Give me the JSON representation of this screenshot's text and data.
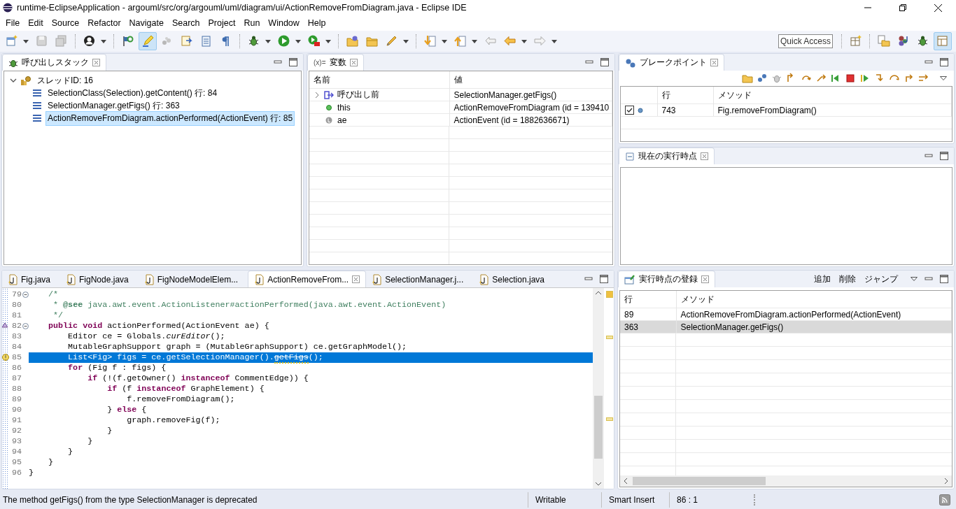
{
  "window": {
    "title": "runtime-EclipseApplication - argouml/src/org/argouml/uml/diagram/ui/ActionRemoveFromDiagram.java - Eclipse IDE"
  },
  "menu": [
    "File",
    "Edit",
    "Source",
    "Refactor",
    "Navigate",
    "Search",
    "Project",
    "Run",
    "Window",
    "Help"
  ],
  "toolbar": [
    {
      "kind": "new-file",
      "menu": true,
      "selected": false
    },
    {
      "kind": "save",
      "menu": false,
      "selected": false
    },
    {
      "kind": "save-all",
      "menu": false,
      "selected": false
    },
    {
      "kind": "separator"
    },
    {
      "kind": "user",
      "menu": true,
      "selected": false
    },
    {
      "kind": "separator"
    },
    {
      "kind": "flag",
      "menu": false,
      "selected": false
    },
    {
      "kind": "pen",
      "menu": false,
      "selected": true
    },
    {
      "kind": "dots",
      "menu": false,
      "selected": false
    },
    {
      "kind": "document",
      "menu": false,
      "selected": false
    },
    {
      "kind": "list",
      "menu": false,
      "selected": false
    },
    {
      "kind": "pilcrow",
      "menu": false,
      "selected": false
    },
    {
      "kind": "separator"
    },
    {
      "kind": "bug",
      "menu": true,
      "selected": false
    },
    {
      "kind": "run",
      "menu": true,
      "selected": false
    },
    {
      "kind": "run-tool",
      "menu": true,
      "selected": false
    },
    {
      "kind": "separator"
    },
    {
      "kind": "folder-sphere",
      "menu": false,
      "selected": false
    },
    {
      "kind": "folder",
      "menu": false,
      "selected": false
    },
    {
      "kind": "brush",
      "menu": true,
      "selected": false
    },
    {
      "kind": "separator"
    },
    {
      "kind": "arrow-down",
      "menu": true,
      "selected": false
    },
    {
      "kind": "arrow-up",
      "menu": true,
      "selected": false
    },
    {
      "kind": "back",
      "menu": false,
      "selected": false
    },
    {
      "kind": "arrow-left",
      "menu": true,
      "selected": false
    },
    {
      "kind": "arrow-right",
      "menu": true,
      "selected": false
    }
  ],
  "quick_access": {
    "placeholder": "Quick Access"
  },
  "perspectives": [
    {
      "kind": "table-plus",
      "selected": false
    },
    {
      "kind": "documents",
      "selected": false
    },
    {
      "kind": "beans",
      "selected": false
    },
    {
      "kind": "bug",
      "selected": false
    },
    {
      "kind": "layout",
      "selected": true
    }
  ],
  "call_stack": {
    "tab": {
      "label": "呼び出しスタック",
      "selected": true
    },
    "threads": [
      {
        "label": "スレッドID: 16",
        "expanded": true,
        "children": [
          {
            "label": "SelectionClass(Selection).getContent() 行: 84",
            "selected": false
          },
          {
            "label": "SelectionManager.getFigs() 行: 363",
            "selected": false
          },
          {
            "label": "ActionRemoveFromDiagram.actionPerformed(ActionEvent) 行: 85",
            "selected": true
          }
        ]
      }
    ]
  },
  "variables": {
    "tab": {
      "icon_text": "(x)=",
      "label": "変数",
      "selected": true
    },
    "columns": [
      "名前",
      "値"
    ],
    "rows": [
      {
        "kind": "return",
        "name": "呼び出し前",
        "value": "SelectionManager.getFigs()",
        "expanded": false
      },
      {
        "kind": "field",
        "name": "this",
        "value": "ActionRemoveFromDiagram (id = 139410"
      },
      {
        "kind": "local",
        "name": "ae",
        "value": "ActionEvent (id = 1882636671)"
      }
    ]
  },
  "breakpoints": {
    "tab": {
      "label": "ブレークポイント",
      "selected": true
    },
    "columns": [
      "行",
      "メソッド"
    ],
    "rows": [
      {
        "checked": true,
        "line": "743",
        "method": "Fig.removeFromDiagram()"
      }
    ]
  },
  "current_point": {
    "tab": {
      "label": "現在の実行時点",
      "selected": true
    }
  },
  "editor": {
    "tabs": [
      {
        "label": "Fig.java",
        "selected": false
      },
      {
        "label": "FigNode.java",
        "selected": false
      },
      {
        "label": "FigNodeModelElem...",
        "selected": false
      },
      {
        "label": "ActionRemoveFrom...",
        "selected": true
      },
      {
        "label": "SelectionManager.j...",
        "selected": false
      },
      {
        "label": "Selection.java",
        "selected": false
      }
    ],
    "lines": [
      {
        "number": "79",
        "fold": true,
        "kind": "plain",
        "selected": false,
        "tokens": [
          {
            "kind": "comment",
            "text": "    /*"
          }
        ]
      },
      {
        "number": "80",
        "fold": false,
        "kind": "plain",
        "selected": false,
        "tokens": [
          {
            "kind": "comment",
            "text": "     * "
          },
          {
            "kind": "doc-tag",
            "text": "@see"
          },
          {
            "kind": "comment",
            "text": " java.awt.event.ActionListener#actionPerformed(java.awt.event.ActionEvent)"
          }
        ]
      },
      {
        "number": "81",
        "fold": false,
        "kind": "plain",
        "selected": false,
        "tokens": [
          {
            "kind": "comment",
            "text": "     */"
          }
        ]
      },
      {
        "number": "82",
        "fold": true,
        "kind": "override",
        "selected": false,
        "tokens": [
          {
            "kind": "keyword",
            "text": "    public void"
          },
          {
            "kind": "plain",
            "text": " actionPerformed(ActionEvent ae) {"
          }
        ]
      },
      {
        "number": "83",
        "fold": false,
        "kind": "plain",
        "selected": false,
        "tokens": [
          {
            "kind": "plain",
            "text": "        Editor ce = Globals."
          },
          {
            "kind": "static",
            "text": "curEditor"
          },
          {
            "kind": "plain",
            "text": "();"
          }
        ]
      },
      {
        "number": "84",
        "fold": false,
        "kind": "plain",
        "selected": false,
        "tokens": [
          {
            "kind": "plain",
            "text": "        MutableGraphSupport graph = (MutableGraphSupport) ce.getGraphModel();"
          }
        ]
      },
      {
        "number": "85",
        "fold": false,
        "kind": "warning",
        "selected": true,
        "tokens": [
          {
            "kind": "plain",
            "text": "        List<Fig> figs = ce.getSelectionManager()."
          },
          {
            "kind": "deprecated",
            "text": "getFigs"
          },
          {
            "kind": "plain",
            "text": "();"
          }
        ]
      },
      {
        "number": "86",
        "fold": false,
        "kind": "plain",
        "selected": false,
        "tokens": [
          {
            "kind": "keyword",
            "text": "        for"
          },
          {
            "kind": "plain",
            "text": " (Fig f : figs) {"
          }
        ]
      },
      {
        "number": "87",
        "fold": false,
        "kind": "plain",
        "selected": false,
        "tokens": [
          {
            "kind": "keyword",
            "text": "            if"
          },
          {
            "kind": "plain",
            "text": " (!(f.getOwner() "
          },
          {
            "kind": "keyword",
            "text": "instanceof"
          },
          {
            "kind": "plain",
            "text": " CommentEdge)) {"
          }
        ]
      },
      {
        "number": "88",
        "fold": false,
        "kind": "plain",
        "selected": false,
        "tokens": [
          {
            "kind": "keyword",
            "text": "                if"
          },
          {
            "kind": "plain",
            "text": " (f "
          },
          {
            "kind": "keyword",
            "text": "instanceof"
          },
          {
            "kind": "plain",
            "text": " GraphElement) {"
          }
        ]
      },
      {
        "number": "89",
        "fold": false,
        "kind": "plain",
        "selected": false,
        "tokens": [
          {
            "kind": "plain",
            "text": "                    f.removeFromDiagram();"
          }
        ]
      },
      {
        "number": "90",
        "fold": false,
        "kind": "plain",
        "selected": false,
        "tokens": [
          {
            "kind": "plain",
            "text": "                } "
          },
          {
            "kind": "keyword",
            "text": "else"
          },
          {
            "kind": "plain",
            "text": " {"
          }
        ]
      },
      {
        "number": "91",
        "fold": false,
        "kind": "plain",
        "selected": false,
        "tokens": [
          {
            "kind": "plain",
            "text": "                    graph.removeFig(f);"
          }
        ]
      },
      {
        "number": "92",
        "fold": false,
        "kind": "plain",
        "selected": false,
        "tokens": [
          {
            "kind": "plain",
            "text": "                }"
          }
        ]
      },
      {
        "number": "93",
        "fold": false,
        "kind": "plain",
        "selected": false,
        "tokens": [
          {
            "kind": "plain",
            "text": "            }"
          }
        ]
      },
      {
        "number": "94",
        "fold": false,
        "kind": "plain",
        "selected": false,
        "tokens": [
          {
            "kind": "plain",
            "text": "        }"
          }
        ]
      },
      {
        "number": "95",
        "fold": false,
        "kind": "plain",
        "selected": false,
        "tokens": [
          {
            "kind": "plain",
            "text": "    }"
          }
        ]
      },
      {
        "number": "96",
        "fold": false,
        "kind": "plain",
        "selected": false,
        "tokens": [
          {
            "kind": "plain",
            "text": "}"
          }
        ]
      }
    ]
  },
  "registrations": {
    "tab": {
      "label": "実行時点の登録",
      "selected": true
    },
    "actions": [
      "追加",
      "削除",
      "ジャンプ"
    ],
    "columns": [
      "行",
      "メソッド"
    ],
    "rows": [
      {
        "line": "89",
        "method": "ActionRemoveFromDiagram.actionPerformed(ActionEvent)",
        "selected": false
      },
      {
        "line": "363",
        "method": "SelectionManager.getFigs()",
        "selected": true
      }
    ]
  },
  "status_bar": {
    "message": "The method getFigs() from the type SelectionManager is deprecated",
    "writable": "Writable",
    "insert_mode": "Smart Insert",
    "position": "86 : 1"
  }
}
